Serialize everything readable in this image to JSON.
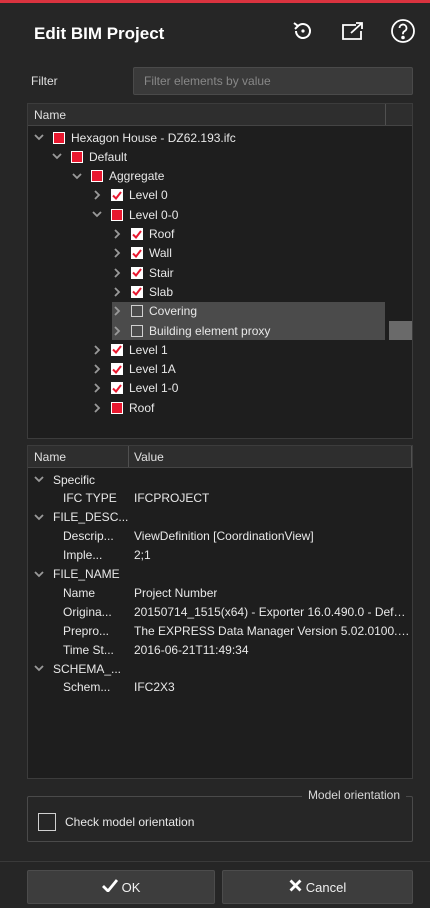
{
  "window": {
    "title": "Edit BIM Project",
    "accent": "#d9333f",
    "icons": [
      "reset-icon",
      "export-icon",
      "help-icon"
    ]
  },
  "filter": {
    "label": "Filter",
    "placeholder": "Filter elements by value",
    "value": ""
  },
  "tree": {
    "header": "Name",
    "items": [
      {
        "label": "Hexagon House - DZ62.193.ifc",
        "state": "partial",
        "expanded": true,
        "level": 0
      },
      {
        "label": "Default",
        "state": "partial",
        "expanded": true,
        "level": 1
      },
      {
        "label": "Aggregate",
        "state": "partial",
        "expanded": true,
        "level": 2
      },
      {
        "label": "Level 0",
        "state": "checked",
        "expanded": false,
        "level": 3
      },
      {
        "label": "Level 0-0",
        "state": "partial",
        "expanded": true,
        "level": 3
      },
      {
        "label": "Roof",
        "state": "checked",
        "expanded": false,
        "level": 4
      },
      {
        "label": "Wall",
        "state": "checked",
        "expanded": false,
        "level": 4
      },
      {
        "label": "Stair",
        "state": "checked",
        "expanded": false,
        "level": 4
      },
      {
        "label": "Slab",
        "state": "checked",
        "expanded": false,
        "level": 4
      },
      {
        "label": "Covering",
        "state": "empty",
        "expanded": false,
        "level": 4,
        "highlight": true
      },
      {
        "label": "Building element proxy",
        "state": "empty",
        "expanded": false,
        "level": 4,
        "highlight": true
      },
      {
        "label": "Level 1",
        "state": "checked",
        "expanded": false,
        "level": 3
      },
      {
        "label": "Level 1A",
        "state": "checked",
        "expanded": false,
        "level": 3
      },
      {
        "label": "Level 1-0",
        "state": "checked",
        "expanded": false,
        "level": 3
      },
      {
        "label": "Roof",
        "state": "partial",
        "expanded": false,
        "level": 3
      }
    ]
  },
  "properties": {
    "headers": {
      "name": "Name",
      "value": "Value"
    },
    "groups": [
      {
        "label": "Specific",
        "rows": [
          {
            "name": "IFC TYPE",
            "value": "IFCPROJECT"
          }
        ]
      },
      {
        "label": "FILE_DESC...",
        "rows": [
          {
            "name": "Descrip...",
            "value": "ViewDefinition [CoordinationView]"
          },
          {
            "name": "Imple...",
            "value": "2;1"
          }
        ]
      },
      {
        "label": "FILE_NAME",
        "rows": [
          {
            "name": "Name",
            "value": "Project Number"
          },
          {
            "name": "Origina...",
            "value": "20150714_1515(x64) - Exporter 16.0.490.0 - Defa..."
          },
          {
            "name": "Prepro...",
            "value": "The EXPRESS Data Manager Version 5.02.0100.07..."
          },
          {
            "name": "Time St...",
            "value": "2016-06-21T11:49:34"
          }
        ]
      },
      {
        "label": "SCHEMA_...",
        "rows": [
          {
            "name": "Schem...",
            "value": "IFC2X3"
          }
        ]
      }
    ]
  },
  "orientation": {
    "group_title": "Model orientation",
    "checkbox_label": "Check model orientation",
    "checked": false
  },
  "footer": {
    "ok_label": "OK",
    "cancel_label": "Cancel"
  }
}
